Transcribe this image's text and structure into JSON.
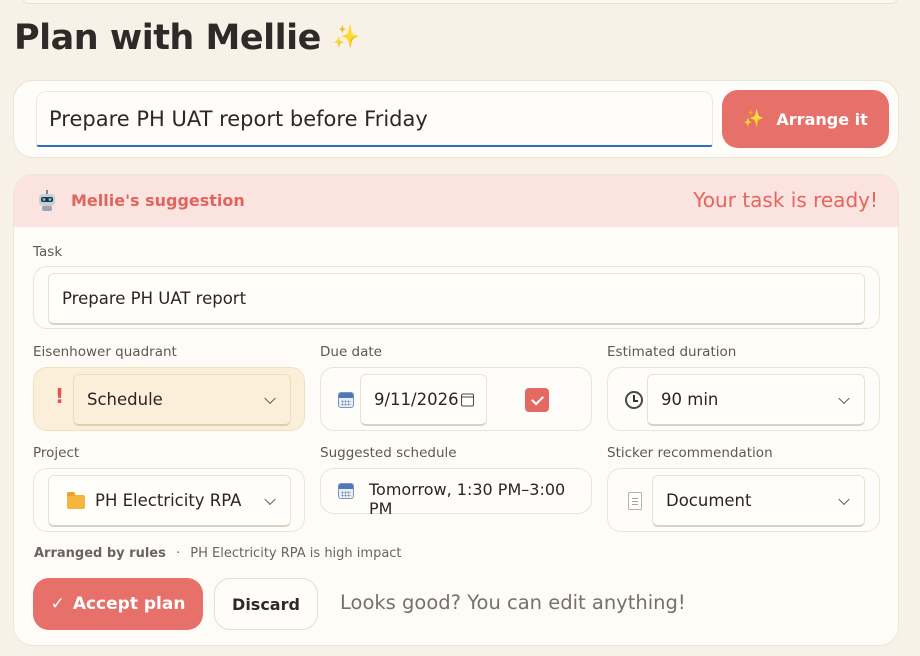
{
  "page": {
    "title": "Plan with Mellie",
    "title_icon": "sparkle-icon"
  },
  "composer": {
    "input_value": "Prepare PH UAT report before Friday",
    "arrange_label": "Arrange it",
    "arrange_icon": "sparkle-icon"
  },
  "suggestion": {
    "header": "Mellie's suggestion",
    "header_icon": "robot-icon",
    "status": "Your task is ready!",
    "task": {
      "label": "Task",
      "value": "Prepare PH UAT report"
    },
    "quadrant": {
      "label": "Eisenhower quadrant",
      "value": "Schedule",
      "icon": "exclamation-icon"
    },
    "due_date": {
      "label": "Due date",
      "value": "9/11/2026",
      "checked": true,
      "icon": "calendar-icon"
    },
    "duration": {
      "label": "Estimated duration",
      "value": "90 min",
      "icon": "clock-icon"
    },
    "project": {
      "label": "Project",
      "value": "PH Electricity RPA",
      "icon": "folder-icon"
    },
    "schedule": {
      "label": "Suggested schedule",
      "value": "Tomorrow, 1:30 PM–3:00 PM",
      "icon": "calendar-icon"
    },
    "sticker": {
      "label": "Sticker recommendation",
      "value": "Document",
      "icon": "document-icon"
    },
    "meta": {
      "source": "Arranged by rules",
      "separator": "·",
      "reason": "PH Electricity RPA is high impact"
    },
    "accept_label": "Accept plan",
    "accept_icon_glyph": "✓",
    "discard_label": "Discard",
    "hint": "Looks good? You can edit anything!"
  },
  "colors": {
    "accent": "#e8706a",
    "header_bg": "#fbe3df",
    "quadrant_bg": "#fcefd9",
    "page_bg": "#f7f1e8"
  }
}
